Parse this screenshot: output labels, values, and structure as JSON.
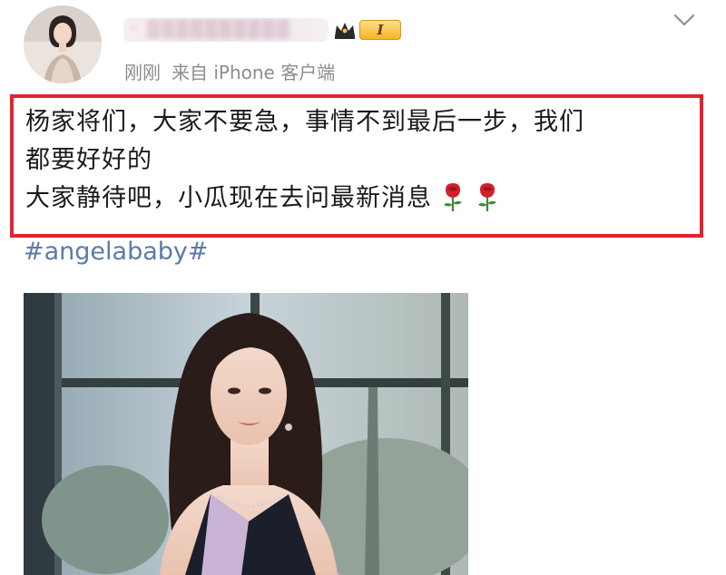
{
  "header": {
    "username": "◦ ▒▒▒▒▒▒▒▒▒▒",
    "level_badge": "I",
    "timestamp": "刚刚",
    "source": "来自 iPhone 客户端"
  },
  "post": {
    "lines": [
      "杨家将们，大家不要急，事情不到最后一步，我们",
      "都要好好的",
      "大家静待吧，小瓜现在去问最新消息"
    ],
    "hashtag": "#angelababy#"
  },
  "icons": {
    "avatar": "avatar",
    "crown": "crown-icon",
    "expand": "chevron-down-icon",
    "rose": "rose-icon"
  },
  "colors": {
    "highlight_border": "#e5222d",
    "hashtag": "#5b7ba8",
    "meta_text": "#8c8c8c"
  }
}
